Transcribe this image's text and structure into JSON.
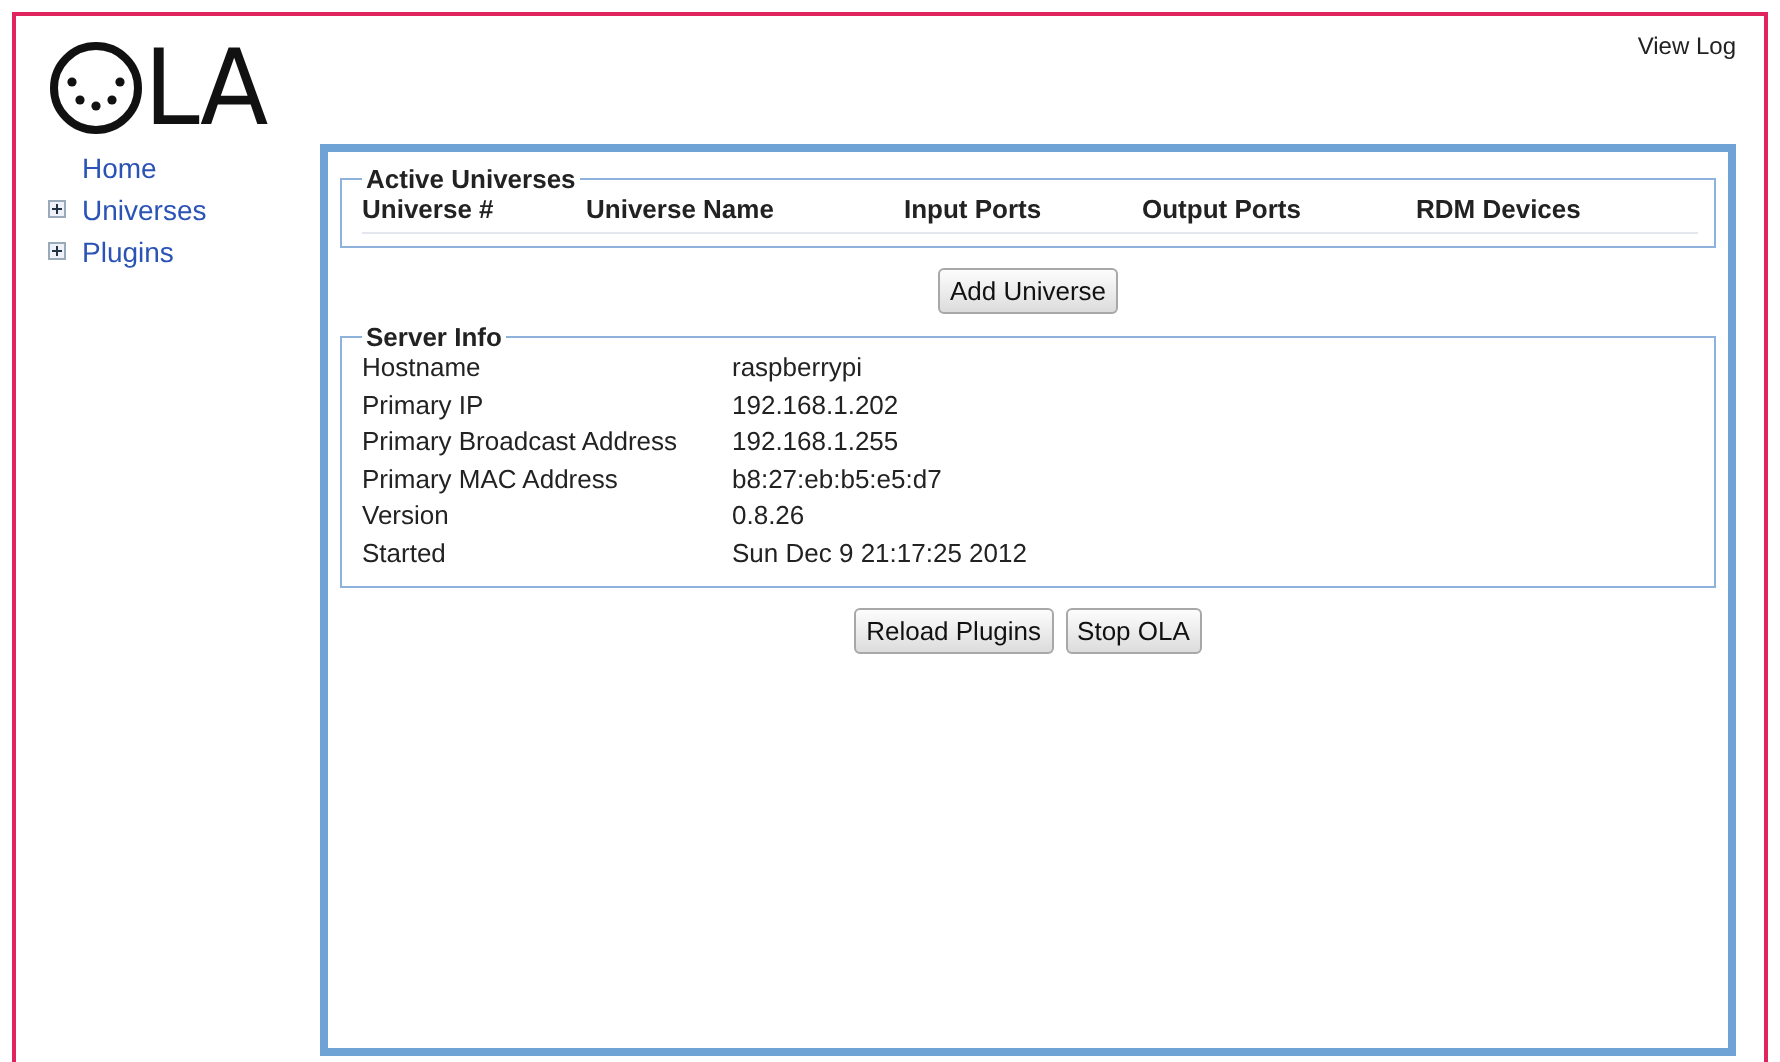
{
  "header": {
    "logo_text": "LA",
    "view_log": "View Log"
  },
  "sidebar": {
    "items": [
      {
        "label": "Home",
        "expandable": false
      },
      {
        "label": "Universes",
        "expandable": true
      },
      {
        "label": "Plugins",
        "expandable": true
      }
    ]
  },
  "active_universes": {
    "legend": "Active Universes",
    "columns": [
      "Universe #",
      "Universe Name",
      "Input Ports",
      "Output Ports",
      "RDM Devices"
    ]
  },
  "add_universe_button": "Add Universe",
  "server_info": {
    "legend": "Server Info",
    "rows": [
      {
        "label": "Hostname",
        "value": "raspberrypi"
      },
      {
        "label": "Primary IP",
        "value": "192.168.1.202"
      },
      {
        "label": "Primary Broadcast Address",
        "value": "192.168.1.255"
      },
      {
        "label": "Primary MAC Address",
        "value": "b8:27:eb:b5:e5:d7"
      },
      {
        "label": "Version",
        "value": "0.8.26"
      },
      {
        "label": "Started",
        "value": "Sun Dec 9 21:17:25 2012"
      }
    ]
  },
  "buttons": [
    "Reload Plugins",
    "Stop OLA"
  ]
}
